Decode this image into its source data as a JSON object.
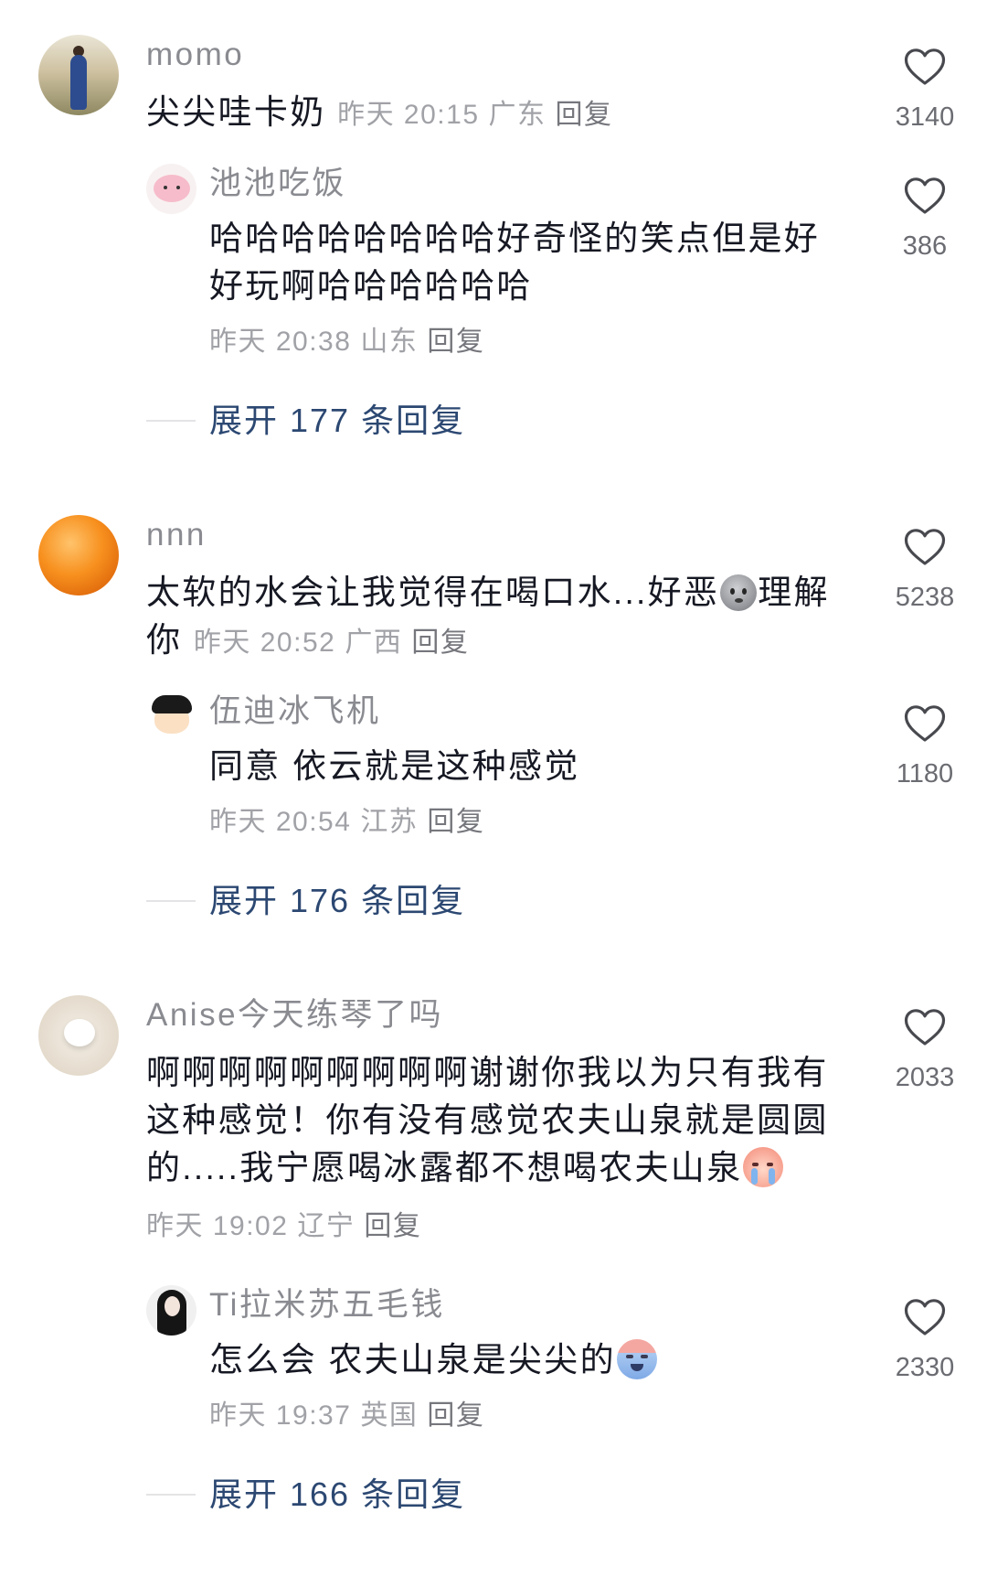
{
  "ui": {
    "reply_label": "回复"
  },
  "icons": {
    "like": "heart-outline-icon"
  },
  "colors": {
    "text": "#161823",
    "username": "#8a8b91",
    "meta": "#a1a2a7",
    "reply": "#76777d",
    "expand": "#2c4872",
    "heart": "#48494f",
    "count": "#6b6c72",
    "divider": "#e4e4e7"
  },
  "comments": [
    {
      "user": "momo",
      "avatar": "woman-in-blue-dress-photo-avatar",
      "text": "尖尖哇卡奶",
      "time": "昨天 20:15",
      "location": "广东",
      "likes": "3140",
      "reply": {
        "user": "池池吃饭",
        "avatar": "pink-cartoon-axolotl-avatar",
        "text": "哈哈哈哈哈哈哈哈好奇怪的笑点但是好好玩啊哈哈哈哈哈哈",
        "time": "昨天 20:38",
        "location": "山东",
        "likes": "386"
      },
      "expand_label": "展开 177 条回复"
    },
    {
      "user": "nnn",
      "avatar": "orange-fruit-photo-avatar",
      "text_before": "太软的水会让我觉得在喝口水...好恶",
      "emoji": "grey-sweat-face-emoji",
      "text_after": "理解你",
      "time": "昨天 20:52",
      "location": "广西",
      "likes": "5238",
      "reply": {
        "user": "伍迪冰飞机",
        "avatar": "crayon-shinchan-cartoon-avatar",
        "text": "同意 依云就是这种感觉",
        "time": "昨天 20:54",
        "location": "江苏",
        "likes": "1180"
      },
      "expand_label": "展开 176 条回复"
    },
    {
      "user": "Anise今天练琴了吗",
      "avatar": "white-figurine-photo-avatar",
      "text_before": "啊啊啊啊啊啊啊啊啊谢谢你我以为只有我有这种感觉！你有没有感觉农夫山泉就是圆圆的.....我宁愿喝冰露都不想喝农夫山泉",
      "emoji": "crying-face-emoji",
      "time": "昨天 19:02",
      "location": "辽宁",
      "likes": "2033",
      "reply": {
        "user": "Ti拉米苏五毛钱",
        "avatar": "girl-black-hair-photo-avatar",
        "text_before": "怎么会 农夫山泉是尖尖的",
        "emoji": "crying-blue-face-emoji",
        "time": "昨天 19:37",
        "location": "英国",
        "likes": "2330"
      },
      "expand_label": "展开 166 条回复"
    }
  ]
}
